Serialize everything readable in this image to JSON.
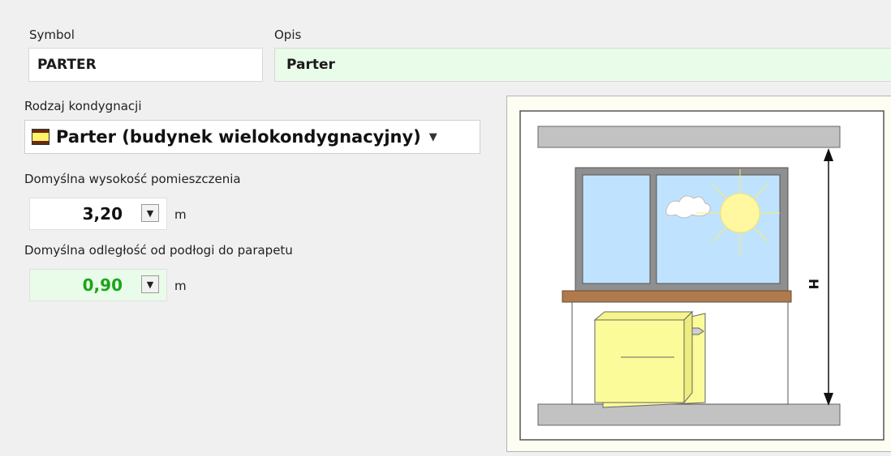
{
  "symbol": {
    "label": "Symbol",
    "value": "PARTER"
  },
  "description": {
    "label": "Opis",
    "value": "Parter"
  },
  "storey_type": {
    "label": "Rodzaj kondygnacji",
    "value": "Parter (budynek wielokondygnacyjny)",
    "icon": "floor-type-icon"
  },
  "room_height": {
    "label": "Domyślna wysokość pomieszczenia",
    "value": "3,20",
    "unit": "m"
  },
  "sill_height": {
    "label": "Domyślna odległość od podłogi do parapetu",
    "value": "0,90",
    "unit": "m"
  },
  "diagram": {
    "dimension_label": "H"
  },
  "colors": {
    "green_field_bg": "#e9fbe9",
    "green_value": "#1aa51a",
    "sill": "#b07a4c",
    "radiator": "#fbfb9a",
    "window_glass": "#bfe3ff",
    "sun": "#fff8a0"
  }
}
